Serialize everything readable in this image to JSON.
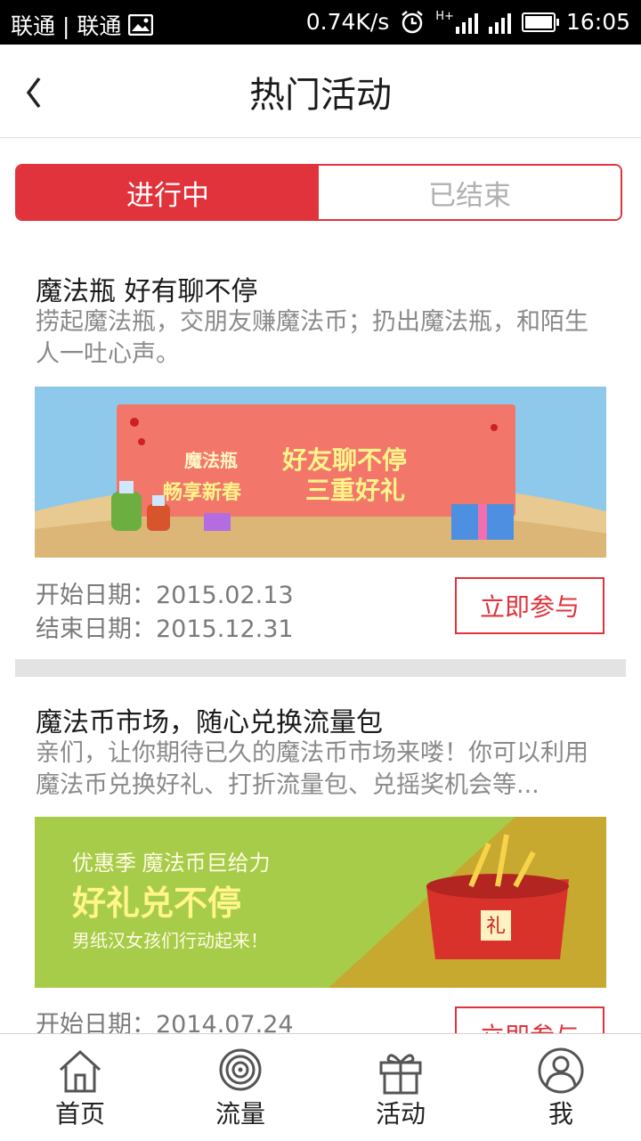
{
  "status_bar": {
    "carriers": "联通 | 联通",
    "speed": "0.74K/s",
    "network": "H+",
    "time": "16:05"
  },
  "header": {
    "title": "热门活动"
  },
  "tabs": [
    {
      "label": "进行中",
      "active": true
    },
    {
      "label": "已结束",
      "active": false
    }
  ],
  "activities": [
    {
      "title": "魔法瓶 好有聊不停",
      "description": "捞起魔法瓶，交朋友赚魔法币；扔出魔法瓶，和陌生人一吐心声。",
      "banner": {
        "line1_small": "魔法瓶",
        "line1_big": "好友聊不停",
        "line2_small": "畅享新春",
        "line2_big": "三重好礼"
      },
      "start_date": "开始日期：2015.02.13",
      "end_date": "结束日期：2015.12.31",
      "button": "立即参与"
    },
    {
      "title": "魔法币市场，随心兑换流量包",
      "description": "亲们，让你期待已久的魔法币市场来喽！你可以利用魔法币兑换好礼、打折流量包、兑摇奖机会等...",
      "banner": {
        "line1": "优惠季 魔法币巨给力",
        "line2": "好礼兑不停",
        "line3": "男纸汉女孩们行动起来！",
        "gift_char": "礼"
      },
      "start_date": "开始日期：2014.07.24",
      "button": "立即参与"
    }
  ],
  "bottom_nav": [
    {
      "label": "首页",
      "icon": "home-icon"
    },
    {
      "label": "流量",
      "icon": "signal-icon"
    },
    {
      "label": "活动",
      "icon": "gift-icon"
    },
    {
      "label": "我",
      "icon": "user-icon"
    }
  ],
  "colors": {
    "accent": "#e0333c"
  }
}
